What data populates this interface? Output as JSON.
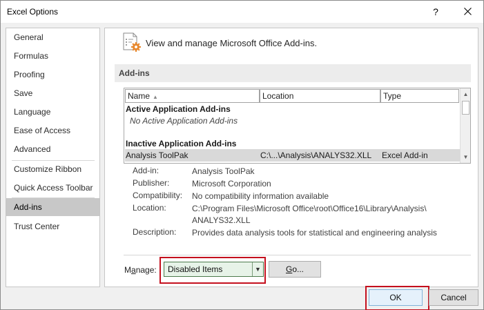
{
  "window": {
    "title": "Excel Options",
    "help_glyph": "?",
    "close_glyph": "✕"
  },
  "sidebar": {
    "items": [
      {
        "label": "General"
      },
      {
        "label": "Formulas"
      },
      {
        "label": "Proofing"
      },
      {
        "label": "Save"
      },
      {
        "label": "Language"
      },
      {
        "label": "Ease of Access"
      },
      {
        "label": "Advanced"
      },
      {
        "label": "Customize Ribbon"
      },
      {
        "label": "Quick Access Toolbar"
      },
      {
        "label": "Add-ins",
        "selected": true
      },
      {
        "label": "Trust Center"
      }
    ]
  },
  "main": {
    "header_text": "View and manage Microsoft Office Add-ins.",
    "section_title": "Add-ins",
    "list": {
      "columns": {
        "name": "Name",
        "sort_glyph": "▲",
        "location": "Location",
        "type": "Type"
      },
      "group_active": "Active Application Add-ins",
      "active_empty": "No Active Application Add-ins",
      "group_inactive": "Inactive Application Add-ins",
      "rows": [
        {
          "name": "Analysis ToolPak",
          "location": "C:\\...\\Analysis\\ANALYS32.XLL",
          "type": "Excel Add-in"
        }
      ]
    },
    "details": {
      "addin_label": "Add-in:",
      "addin_value": "Analysis ToolPak",
      "publisher_label": "Publisher:",
      "publisher_value": "Microsoft Corporation",
      "compat_label": "Compatibility:",
      "compat_value": "No compatibility information available",
      "location_label": "Location:",
      "location_value": "C:\\Program Files\\Microsoft Office\\root\\Office16\\Library\\Analysis\\\nANALYS32.XLL",
      "description_label": "Description:",
      "description_value": "Provides data analysis tools for statistical and engineering analysis"
    },
    "manage": {
      "label_prefix": "M",
      "label_accel": "a",
      "label_suffix": "nage:",
      "selected": "Disabled Items",
      "go_accel": "G",
      "go_suffix": "o..."
    }
  },
  "footer": {
    "ok_label": "OK",
    "cancel_label": "Cancel"
  },
  "colors": {
    "highlight_box": "#c40f1d",
    "selected_nav": "#c8c8c8",
    "ok_button": "#e5f1fb"
  }
}
